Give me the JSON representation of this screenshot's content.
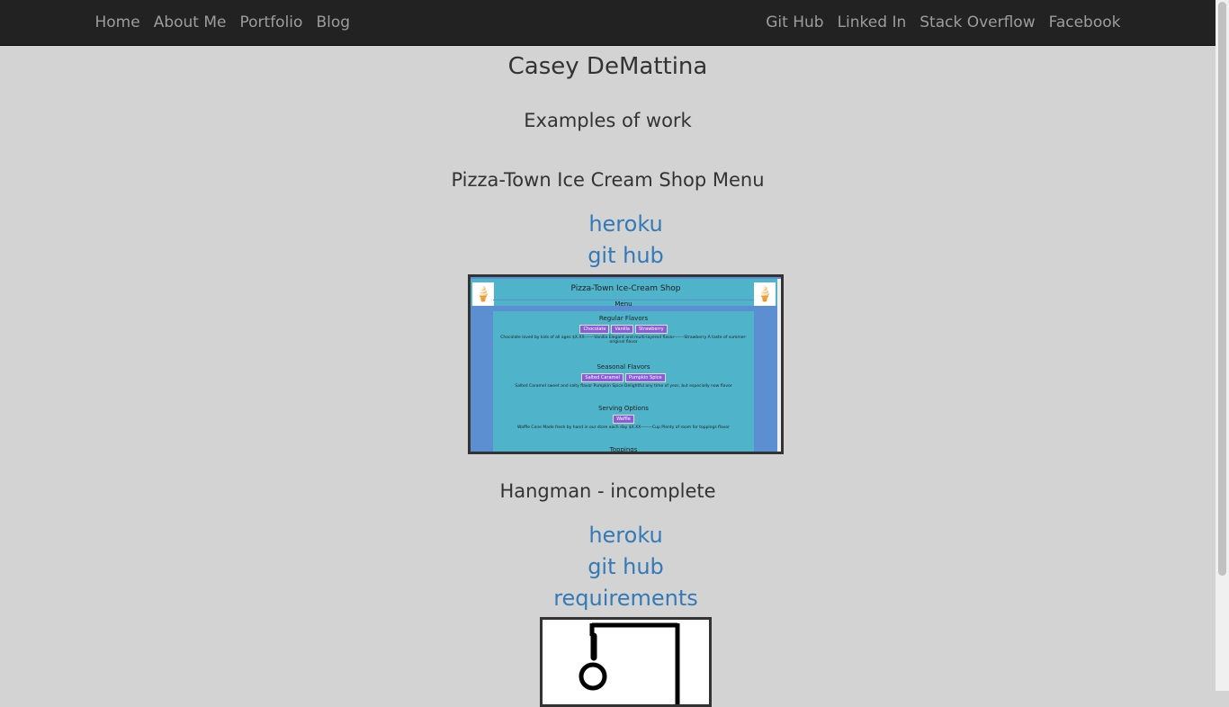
{
  "nav": {
    "left": [
      "Home",
      "About Me",
      "Portfolio",
      "Blog"
    ],
    "right": [
      "Git Hub",
      "Linked In",
      "Stack Overflow",
      "Facebook"
    ]
  },
  "header": {
    "title": "Casey DeMattina",
    "subtitle": "Examples of work"
  },
  "projects": [
    {
      "title": "Pizza-Town Ice Cream Shop Menu",
      "links": [
        "heroku",
        "git hub"
      ],
      "screenshot": {
        "title": "Pizza-Town Ice-Cream Shop",
        "menu": "Menu",
        "regular_heading": "Regular Flavors",
        "regular_buttons": [
          "Chocolate",
          "Vanilla",
          "Strawberry"
        ],
        "regular_desc": "Chocolate loved by kids of all ages $X.XX-------Vanilla Elegant and multi-layered flavor-------Strawberry A taste of summer-original flavor",
        "seasonal_heading": "Seasonal Flavors",
        "seasonal_buttons": [
          "Salted Caramel",
          "Pumpkin Spice"
        ],
        "seasonal_desc": "Salted Caramel sweet and salty flavor         Pumpkin Spice Delightful any time of year, but especially now flavor",
        "serving_heading": "Serving Options",
        "serving_buttons": [
          "Waffle"
        ],
        "serving_desc": "Waffle Cone Made fresh by hand in our store each day $X.XX--------Cup Plenty of room for toppings flavor",
        "toppings_heading": "Toppings"
      }
    },
    {
      "title": "Hangman - incomplete",
      "links": [
        "heroku",
        "git hub",
        "requirements"
      ]
    }
  ]
}
